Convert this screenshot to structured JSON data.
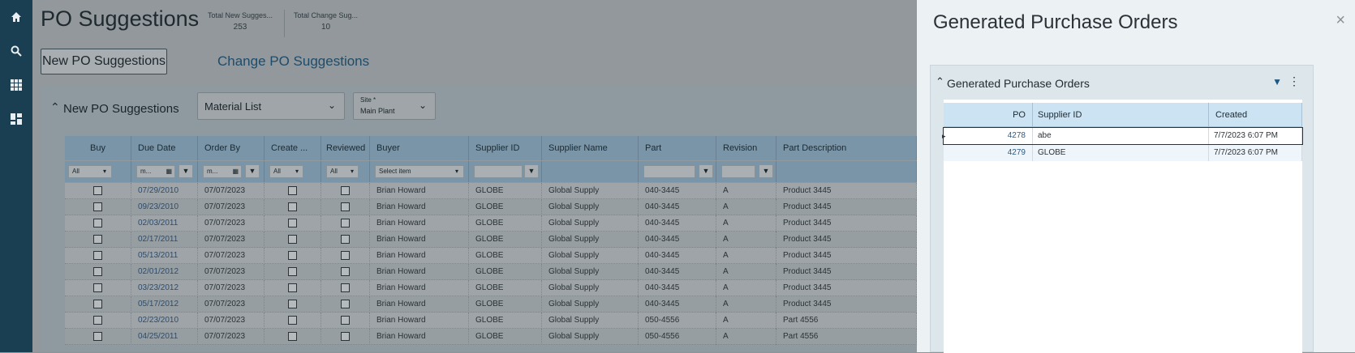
{
  "nav": {
    "icons": [
      "home-icon",
      "search-icon",
      "apps-grid-icon",
      "dashboard-icon"
    ]
  },
  "page": {
    "title": "PO Suggestions",
    "kpis": [
      {
        "label": "Total New Sugges...",
        "value": "253"
      },
      {
        "label": "Total Change Sug...",
        "value": "10"
      }
    ],
    "tabs": {
      "active": "New PO Suggestions",
      "other": "Change PO Suggestions"
    }
  },
  "panel": {
    "title": "New PO Suggestions",
    "view_select": "Material List",
    "site": {
      "label": "Site *",
      "value": "Main Plant"
    }
  },
  "grid": {
    "columns": [
      "Buy",
      "Due Date",
      "Order By",
      "Create ...",
      "Reviewed",
      "Buyer",
      "Supplier ID",
      "Supplier Name",
      "Part",
      "Revision",
      "Part Description"
    ],
    "filters": {
      "buy": "All",
      "due_date": "m...",
      "order_by": "m...",
      "create": "All",
      "reviewed": "All",
      "buyer": "Select item"
    },
    "rows": [
      {
        "due": "07/29/2010",
        "order_by": "07/07/2023",
        "buyer": "Brian Howard",
        "supplier_id": "GLOBE",
        "supplier_name": "Global Supply",
        "part": "040-3445",
        "rev": "A",
        "desc": "Product 3445"
      },
      {
        "due": "09/23/2010",
        "order_by": "07/07/2023",
        "buyer": "Brian Howard",
        "supplier_id": "GLOBE",
        "supplier_name": "Global Supply",
        "part": "040-3445",
        "rev": "A",
        "desc": "Product 3445"
      },
      {
        "due": "02/03/2011",
        "order_by": "07/07/2023",
        "buyer": "Brian Howard",
        "supplier_id": "GLOBE",
        "supplier_name": "Global Supply",
        "part": "040-3445",
        "rev": "A",
        "desc": "Product 3445"
      },
      {
        "due": "02/17/2011",
        "order_by": "07/07/2023",
        "buyer": "Brian Howard",
        "supplier_id": "GLOBE",
        "supplier_name": "Global Supply",
        "part": "040-3445",
        "rev": "A",
        "desc": "Product 3445"
      },
      {
        "due": "05/13/2011",
        "order_by": "07/07/2023",
        "buyer": "Brian Howard",
        "supplier_id": "GLOBE",
        "supplier_name": "Global Supply",
        "part": "040-3445",
        "rev": "A",
        "desc": "Product 3445"
      },
      {
        "due": "02/01/2012",
        "order_by": "07/07/2023",
        "buyer": "Brian Howard",
        "supplier_id": "GLOBE",
        "supplier_name": "Global Supply",
        "part": "040-3445",
        "rev": "A",
        "desc": "Product 3445"
      },
      {
        "due": "03/23/2012",
        "order_by": "07/07/2023",
        "buyer": "Brian Howard",
        "supplier_id": "GLOBE",
        "supplier_name": "Global Supply",
        "part": "040-3445",
        "rev": "A",
        "desc": "Product 3445"
      },
      {
        "due": "05/17/2012",
        "order_by": "07/07/2023",
        "buyer": "Brian Howard",
        "supplier_id": "GLOBE",
        "supplier_name": "Global Supply",
        "part": "040-3445",
        "rev": "A",
        "desc": "Product 3445"
      },
      {
        "due": "02/23/2010",
        "order_by": "07/07/2023",
        "buyer": "Brian Howard",
        "supplier_id": "GLOBE",
        "supplier_name": "Global Supply",
        "part": "050-4556",
        "rev": "A",
        "desc": "Part 4556"
      },
      {
        "due": "04/25/2011",
        "order_by": "07/07/2023",
        "buyer": "Brian Howard",
        "supplier_id": "GLOBE",
        "supplier_name": "Global Supply",
        "part": "050-4556",
        "rev": "A",
        "desc": "Part 4556"
      }
    ]
  },
  "flyout": {
    "title": "Generated Purchase Orders",
    "close": "×",
    "panel_title": "Generated Purchase Orders",
    "columns": [
      "PO",
      "Supplier ID",
      "Created"
    ],
    "rows": [
      {
        "po": "4278",
        "supplier": "abe",
        "created": "7/7/2023 6:07 PM"
      },
      {
        "po": "4279",
        "supplier": "GLOBE",
        "created": "7/7/2023 6:07 PM"
      }
    ]
  }
}
